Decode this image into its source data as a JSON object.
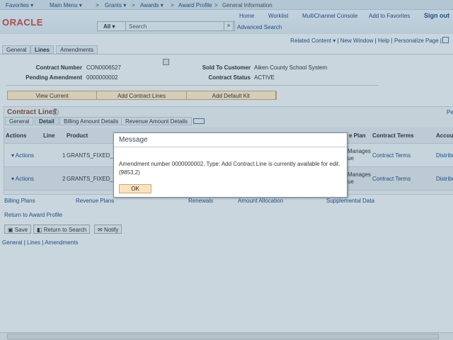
{
  "nav": {
    "favorites": "Favorites ▾",
    "main_menu": "Main Menu ▾",
    "grants": "Grants ▾",
    "awards": "Awards ▾",
    "award_profile": "Award Profile",
    "general_info": "General Information",
    "sep": ">"
  },
  "header": {
    "logo": "ORACLE",
    "links": [
      "Home",
      "Worklist",
      "MultiChannel Console",
      "Add to Favorites",
      "Sign out"
    ],
    "search_scope": "All",
    "search_placeholder": "Search",
    "advanced_search": "Advanced Search"
  },
  "pagebar": {
    "related": "Related Content ▾",
    "new_window": "New Window",
    "help": "Help",
    "personalize": "Personalize Page"
  },
  "tabs": [
    "General",
    "Lines",
    "Amendments"
  ],
  "fields": {
    "contract_number_label": "Contract Number",
    "contract_number": "CON0006527",
    "pending_label": "Pending Amendment",
    "pending": "0000000002",
    "sold_to_label": "Sold To Customer",
    "sold_to": "Aiken County School System",
    "status_label": "Contract Status",
    "status": "ACTIVE"
  },
  "buttons": [
    "View Current",
    "Add Contract Lines",
    "Add Default Kit"
  ],
  "grid": {
    "title": "Contract Lines",
    "help": "?",
    "personalize": "Pe",
    "tabs": [
      "General",
      "Detail",
      "Billing Amount Details",
      "Revenue Amount Details"
    ],
    "headers": [
      "Actions",
      "Line",
      "Product",
      "e Plan",
      "Contract Terms",
      "Accoun"
    ],
    "rows": [
      {
        "actions": "Actions",
        "line": "1",
        "product": "GRANTS_FIXED_F",
        "plan": "Manages\nue",
        "terms": "Contract Terms",
        "acct": "Distribu"
      },
      {
        "actions": "Actions",
        "line": "2",
        "product": "GRANTS_FIXED_F",
        "plan": "Manages\nue",
        "terms": "Contract Terms",
        "acct": "Distribu"
      }
    ]
  },
  "links": [
    "Billing Plans",
    "Revenue Plans",
    "Renewals",
    "Amount Allocation",
    "Supplemental Data"
  ],
  "return_link": "Return to Award Profile",
  "page_buttons": [
    "Save",
    "Return to Search",
    "Notify"
  ],
  "footer_links": [
    "General",
    "Lines",
    "Amendments"
  ],
  "dialog": {
    "title": "Message",
    "text": "Amendment number 0000000002, Type: Add Contract Line is currently available for edit.",
    "code": "(9853,2)",
    "ok": "OK"
  }
}
